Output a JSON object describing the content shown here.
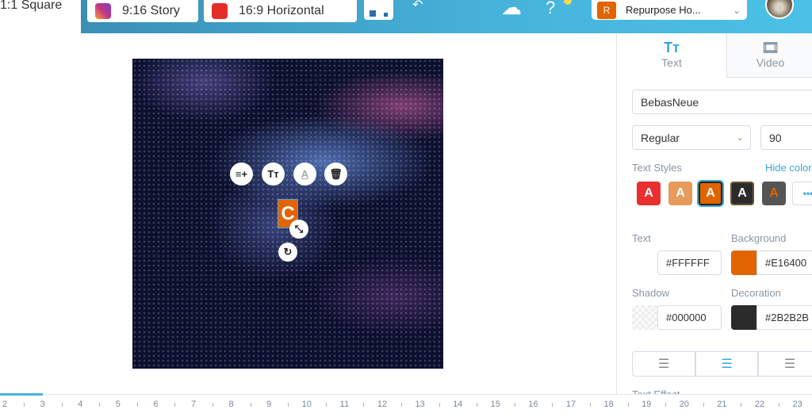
{
  "topbar": {
    "square": "1:1 Square",
    "tabs": [
      {
        "label": "9:16 Story",
        "icon": "instagram-icon",
        "color": "#c13584"
      },
      {
        "label": "16:9 Horizontal",
        "icon": "youtube-icon",
        "color": "#e52d27"
      }
    ],
    "undo": "↶",
    "project": {
      "initial": "R",
      "name": "Repurpose Ho..."
    }
  },
  "canvas": {
    "text": "C",
    "tools": [
      "add-lines-icon",
      "text-size-icon",
      "text-color-icon",
      "trash-icon"
    ]
  },
  "panel": {
    "tabs": [
      {
        "label": "Text",
        "glyph": "Tт"
      },
      {
        "label": "Video",
        "glyph": "🎞"
      }
    ],
    "font": "BebasNeue",
    "weight": "Regular",
    "size": "90",
    "styles_label": "Text Styles",
    "hide_colors": "Hide colors",
    "more": "•••",
    "text_label": "Text",
    "text_color": "#FFFFFF",
    "bg_label": "Background",
    "bg_color": "#E16400",
    "shadow_label": "Shadow",
    "shadow_color": "#000000",
    "decoration_label": "Decoration",
    "decoration_color": "#2B2B2B",
    "effect_label": "Text Effect"
  },
  "ruler": {
    "labels": [
      "2",
      "3",
      "4",
      "5",
      "6",
      "7",
      "8",
      "9",
      "10",
      "11",
      "12",
      "13",
      "14",
      "15",
      "16",
      "17",
      "18",
      "19",
      "20",
      "21",
      "22",
      "23"
    ]
  }
}
